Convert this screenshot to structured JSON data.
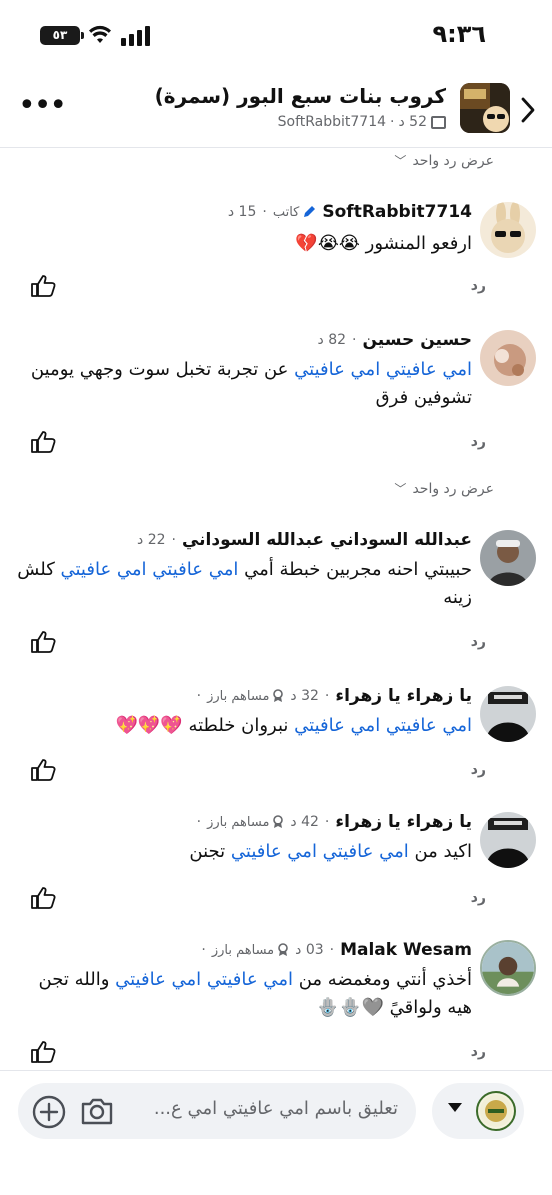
{
  "status_bar": {
    "time": "٩:٣٦",
    "battery": "٥٣"
  },
  "header": {
    "back_icon": "chevron-right-icon",
    "title": "كروب بنات سبع البور (سمرة)",
    "subtitle_author": "SoftRabbit7714",
    "subtitle_time": "52 د",
    "more_icon": "more-horizontal-icon"
  },
  "labels": {
    "view_one_reply": "عرض رد واحد",
    "reply": "رد",
    "author_badge": "كاتب",
    "contributor_badge": "مساهم بارز"
  },
  "comments": [
    {
      "name": "SoftRabbit7714",
      "time": "15 د",
      "badge": "كاتب",
      "text_parts": [
        {
          "t": "ارفعو المنشور 😭😭💔",
          "mention": false
        }
      ]
    },
    {
      "name": "حسين حسين",
      "time": "82 د",
      "badge": "",
      "text_parts": [
        {
          "t": "امي عافيتي امي عافيتي",
          "mention": true
        },
        {
          "t": "  عن تجربة تخبل سوت وجهي يومين تشوفين فرق",
          "mention": false
        }
      ]
    },
    {
      "name": "عبدالله السوداني عبدالله السوداني",
      "time": "22 د",
      "badge": "",
      "text_parts": [
        {
          "t": "حبيبتي احنه مجربين خبطة أمي ",
          "mention": false
        },
        {
          "t": "امي عافيتي امي عافيتي",
          "mention": true
        },
        {
          "t": " كلش زينه",
          "mention": false
        }
      ]
    },
    {
      "name": "يا زهراء يا زهراء",
      "time": "32 د",
      "badge": "مساهم بارز",
      "text_parts": [
        {
          "t": "امي عافيتي امي عافيتي",
          "mention": true
        },
        {
          "t": "  نبروان خلطته 💖💖💖",
          "mention": false
        }
      ]
    },
    {
      "name": "يا زهراء يا زهراء",
      "time": "42 د",
      "badge": "مساهم بارز",
      "text_parts": [
        {
          "t": "اكيد من ",
          "mention": false
        },
        {
          "t": "امي عافيتي امي عافيتي",
          "mention": true
        },
        {
          "t": " تجنن",
          "mention": false
        }
      ]
    },
    {
      "name": "Malak Wesam",
      "time": "03 د",
      "badge": "مساهم بارز",
      "text_parts": [
        {
          "t": "أخذي أنتي ومغمضه من ",
          "mention": false
        },
        {
          "t": "امي عافيتي امي عافيتي",
          "mention": true
        },
        {
          "t": " والله تجن هيه ولواقيً 🩶🪬🪬",
          "mention": false
        }
      ]
    }
  ],
  "composer": {
    "placeholder": "تعليق باسم امي عافيتي امي ع...",
    "camera_icon": "camera-icon",
    "add_icon": "plus-circle-icon"
  },
  "colors": {
    "mention": "#1565d8",
    "secondary_text": "#65676b"
  }
}
